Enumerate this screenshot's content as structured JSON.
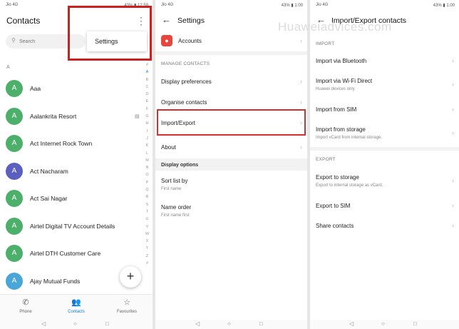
{
  "panel1": {
    "status": {
      "carrier": "Jio 4G",
      "right": "43% ▮ 12:59"
    },
    "title": "Contacts",
    "search_placeholder": "Search",
    "popup_item": "Settings",
    "section_letter": "A",
    "contacts": [
      {
        "initial": "A",
        "name": "Aaa",
        "color": "#4caf6a"
      },
      {
        "initial": "A",
        "name": "Aalankrita Resort",
        "color": "#4caf6a"
      },
      {
        "initial": "A",
        "name": "Act Internet Rock Town",
        "color": "#4caf6a"
      },
      {
        "initial": "A",
        "name": "Act Nacharam",
        "color": "#5b5fbf"
      },
      {
        "initial": "A",
        "name": "Act Sai Nagar",
        "color": "#4caf6a"
      },
      {
        "initial": "A",
        "name": "Airtel Digital TV Account Details",
        "color": "#4caf6a"
      },
      {
        "initial": "A",
        "name": "Airtel DTH Customer Care",
        "color": "#4caf6a"
      },
      {
        "initial": "A",
        "name": "Ajay Mutual Funds",
        "color": "#4aa6d9"
      }
    ],
    "alphabet": [
      "#",
      "A",
      "B",
      "C",
      "D",
      "E",
      "F",
      "G",
      "H",
      "I",
      "J",
      "K",
      "L",
      "M",
      "N",
      "O",
      "P",
      "Q",
      "R",
      "S",
      "T",
      "U",
      "V",
      "W",
      "X",
      "Y",
      "Z",
      "#"
    ],
    "tabs": [
      {
        "icon": "phone-icon",
        "label": "Phone"
      },
      {
        "icon": "contacts-icon",
        "label": "Contacts"
      },
      {
        "icon": "star-icon",
        "label": "Favourites"
      }
    ]
  },
  "panel2": {
    "status": {
      "carrier": "Jio 4G",
      "right": "43% ▮ 1:00"
    },
    "title": "Settings",
    "accounts": "Accounts",
    "manage_header": "MANAGE CONTACTS",
    "items": [
      "Display preferences",
      "Organise contacts",
      "Import/Export",
      "About"
    ],
    "display_options_header": "Display options",
    "sort_list_by": {
      "label": "Sort list by",
      "value": "First name"
    },
    "name_order": {
      "label": "Name order",
      "value": "First name first"
    }
  },
  "panel3": {
    "status": {
      "carrier": "Jio 4G",
      "right": "43% ▮ 1:00"
    },
    "title": "Import/Export contacts",
    "watermark": "Huaweiadvices.com",
    "import_header": "IMPORT",
    "import_items": [
      {
        "label": "Import via Bluetooth",
        "sub": ""
      },
      {
        "label": "Import via Wi-Fi Direct",
        "sub": "Huawei devices only"
      },
      {
        "label": "Import from SIM",
        "sub": ""
      },
      {
        "label": "Import from storage",
        "sub": "Import vCard from internal storage."
      }
    ],
    "export_header": "EXPORT",
    "export_items": [
      {
        "label": "Export to storage",
        "sub": "Export to internal storage as vCard."
      },
      {
        "label": "Export to SIM",
        "sub": ""
      },
      {
        "label": "Share contacts",
        "sub": ""
      }
    ]
  },
  "colors": {
    "accent": "#1a7be0",
    "highlight": "#d43030"
  }
}
